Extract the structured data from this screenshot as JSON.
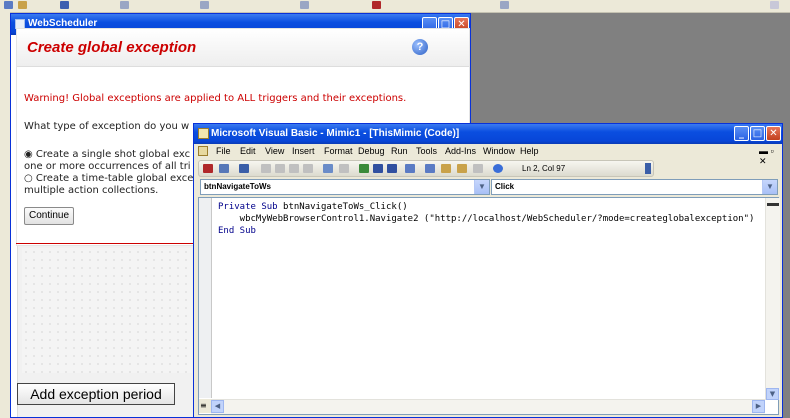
{
  "ws_window": {
    "title": "WebScheduler",
    "panel_title": "Create global exception",
    "help_glyph": "?",
    "warning": "Warning! Global exceptions are applied to ALL triggers and their exceptions.",
    "question": "What type of exception do you w",
    "option1_line1": "Create a single shot global exc",
    "option1_line2": "one or more occurrences of all tri",
    "option2_line1": "Create a time-table global exce",
    "option2_line2": "multiple action collections.",
    "option1_selected": true,
    "continue_label": "Continue",
    "add_period_label": "Add exception period"
  },
  "vb_window": {
    "title": "Microsoft Visual Basic - Mimic1 - [ThisMimic (Code)]",
    "menu": [
      "File",
      "Edit",
      "View",
      "Insert",
      "Format",
      "Debug",
      "Run",
      "Tools",
      "Add-Ins",
      "Window",
      "Help"
    ],
    "cursor_position": "Ln 2, Col 97",
    "object_combo": "btnNavigateToWs",
    "procedure_combo": "Click",
    "code": {
      "line1_kw": "Private Sub",
      "line1_rest": " btnNavigateToWs_Click()",
      "line2": "    wbcMyWebBrowserControl1.Navigate2 (\"http://localhost/WebScheduler/?mode=createglobalexception\")",
      "line3_kw": "End Sub"
    }
  },
  "colors": {
    "xp_title_blue": "#0a4ee0",
    "warning_red": "#cc0000",
    "vb_keyword": "#00008b"
  }
}
